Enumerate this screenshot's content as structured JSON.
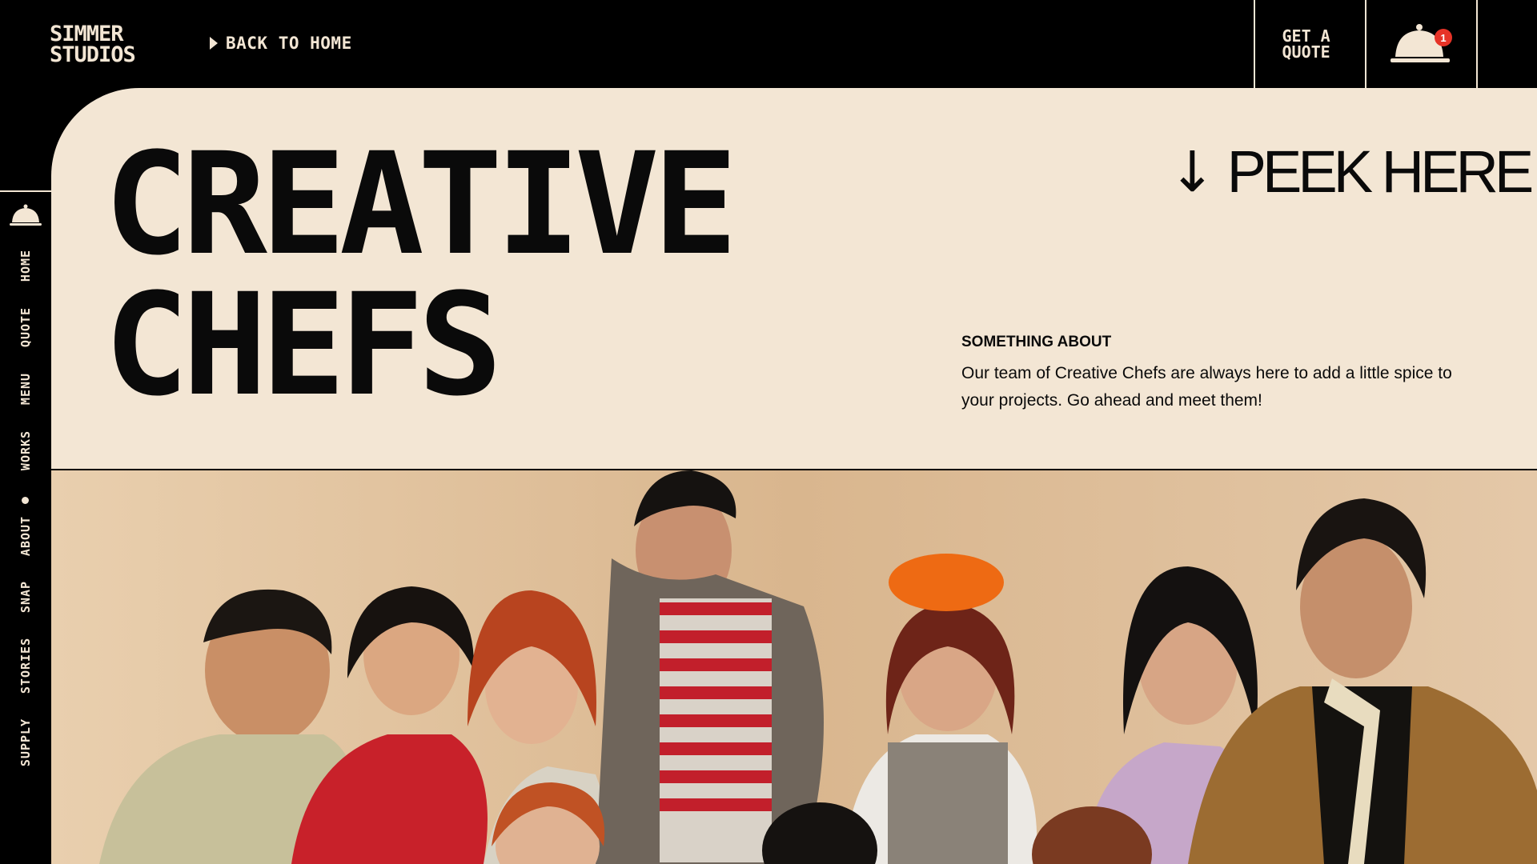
{
  "header": {
    "logo_line1": "SIMMER",
    "logo_line2": "STUDIOS",
    "back_label": "BACK TO HOME",
    "quote_label": "GET A QUOTE",
    "cart_count": "1"
  },
  "sidebar": {
    "items": [
      {
        "label": "HOME"
      },
      {
        "label": "QUOTE"
      },
      {
        "label": "MENU"
      },
      {
        "label": "WORKS"
      },
      {
        "label": "ABOUT"
      },
      {
        "label": "SNAP"
      },
      {
        "label": "STORIES"
      },
      {
        "label": "SUPPLY"
      }
    ],
    "active": "ABOUT"
  },
  "hero": {
    "headline_line1": "CREATIVE",
    "headline_line2": "CHEFS",
    "peek_label": "PEEK HERE",
    "about_title": "SOMETHING ABOUT",
    "about_text": "Our team of Creative Chefs are always here to add a little spice to your projects. Go ahead and meet them!"
  },
  "colors": {
    "cream": "#f3e6d4",
    "black": "#000000",
    "badge_red": "#e63327"
  },
  "icons": {
    "cart": "cloche-icon",
    "peek_arrow": "arrow-down-icon"
  }
}
